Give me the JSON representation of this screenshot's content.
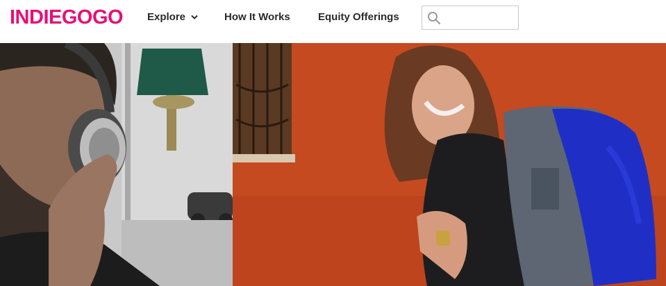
{
  "brand": {
    "logo_text": "INDIEGOGO",
    "color": "#e51075"
  },
  "nav": {
    "explore_label": "Explore",
    "how_it_works_label": "How It Works",
    "equity_label": "Equity Offerings"
  },
  "search": {
    "placeholder": "",
    "icon": "search-icon"
  },
  "hero": {
    "left_image": "man-with-headphones",
    "right_image": "woman-with-blue-backpack",
    "right_bg_color": "#c84a22"
  }
}
